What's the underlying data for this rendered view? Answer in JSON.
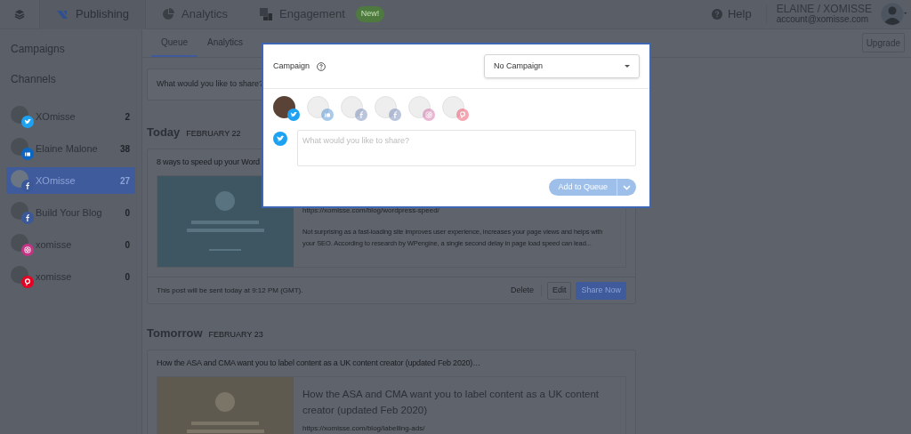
{
  "nav": {
    "items": [
      {
        "label": "Publishing",
        "selected": true
      },
      {
        "label": "Analytics",
        "selected": false
      },
      {
        "label": "Engagement",
        "selected": false,
        "badge": "New!"
      }
    ],
    "help": "Help",
    "user_name": "ELAINE / XOMISSE",
    "user_email": "account@xomisse.com"
  },
  "sidebar": {
    "sections": [
      "Campaigns",
      "Channels"
    ],
    "channels": [
      {
        "name": "XOmisse",
        "count": "2",
        "kind": "twitter",
        "selected": false
      },
      {
        "name": "Elaine Malone",
        "count": "38",
        "kind": "linkedin",
        "selected": false
      },
      {
        "name": "XOmisse",
        "count": "27",
        "kind": "facebook",
        "selected": true
      },
      {
        "name": "Build Your Blog",
        "count": "0",
        "kind": "facebook",
        "selected": false
      },
      {
        "name": "xomisse",
        "count": "0",
        "kind": "instagram",
        "selected": false
      },
      {
        "name": "xomisse",
        "count": "0",
        "kind": "pinterest",
        "selected": false
      }
    ]
  },
  "tabs": [
    {
      "label": "Queue",
      "selected": true
    },
    {
      "label": "Analytics",
      "selected": false
    }
  ],
  "upgrade": "Upgrade",
  "composer_placeholder": "What would you like to share?",
  "days": [
    {
      "day": "Today",
      "date": "FEBRUARY 22",
      "posts": [
        {
          "text": "8 ways to speed up your Word",
          "url": "https://xomisse.com/blog/wordpress-speed/",
          "description": "Not surprising as a fast-loading site improves user experience, increases your page views and helps with your SEO.  According to research by WPengine, a single second delay in page load speed can lead...",
          "footer": "This post will be sent today at 9:12 PM (GMT).",
          "actions": [
            "Delete",
            "Edit",
            "Share Now"
          ]
        }
      ]
    },
    {
      "day": "Tomorrow",
      "date": "FEBRUARY 23",
      "posts": [
        {
          "text": "How the ASA and CMA want you to label content as a UK content creator (updated Feb 2020)…",
          "title": "How the ASA and CMA want you to label content as a UK content creator (updated Feb 2020)",
          "url": "https://xomisse.com/blog/labelling-ads/"
        }
      ]
    }
  ],
  "modal": {
    "campaign_label": "Campaign",
    "campaign_value": "No Campaign",
    "profiles": [
      {
        "kind": "twitter",
        "selected": true
      },
      {
        "kind": "linkedin",
        "selected": false
      },
      {
        "kind": "facebook",
        "selected": false
      },
      {
        "kind": "facebook",
        "selected": false
      },
      {
        "kind": "instagram",
        "selected": false
      },
      {
        "kind": "pinterest",
        "selected": false
      }
    ],
    "placeholder": "What would you like to share?",
    "submit": "Add to Queue",
    "submit_disabled": true
  }
}
